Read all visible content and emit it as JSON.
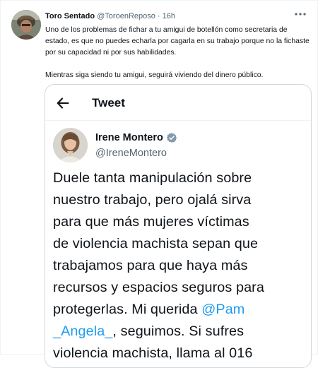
{
  "tweet": {
    "author_name": "Toro Sentado",
    "author_handle": "@ToroenReposo",
    "separator": "·",
    "time": "16h",
    "paragraph1": "Uno de los problemas de fichar a tu amigui de botellón como secretaria de estado, es que no puedes echarla por cagarla en su trabajo porque no la fichaste por su capacidad ni por sus habilidades.",
    "paragraph2": "Mientras siga siendo tu amigui, seguirá viviendo del dinero público."
  },
  "quoted": {
    "header_title": "Tweet",
    "author_name": "Irene Montero",
    "author_handle": "@IreneMontero",
    "lines": [
      "Duele tanta manipulación sobre",
      "nuestro trabajo, pero ojalá sirva",
      "para que más mujeres víctimas",
      "de violencia machista sepan que",
      "trabajamos para que haya más",
      "recursos y espacios seguros para"
    ],
    "line7_text": "protegerlas. Mi querida ",
    "mention_part1": "@Pam",
    "mention_part2": "_Angela_",
    "line8_text": ", seguimos. Si sufres",
    "line9_text": "violencia machista, llama al 016"
  },
  "colors": {
    "link": "#1d9bf0",
    "text_primary": "#0f1419",
    "text_secondary": "#536471",
    "border": "#cfd9de"
  },
  "icons": {
    "more": "more-dots-icon",
    "back": "back-arrow-icon",
    "verified": "verified-badge-icon"
  }
}
